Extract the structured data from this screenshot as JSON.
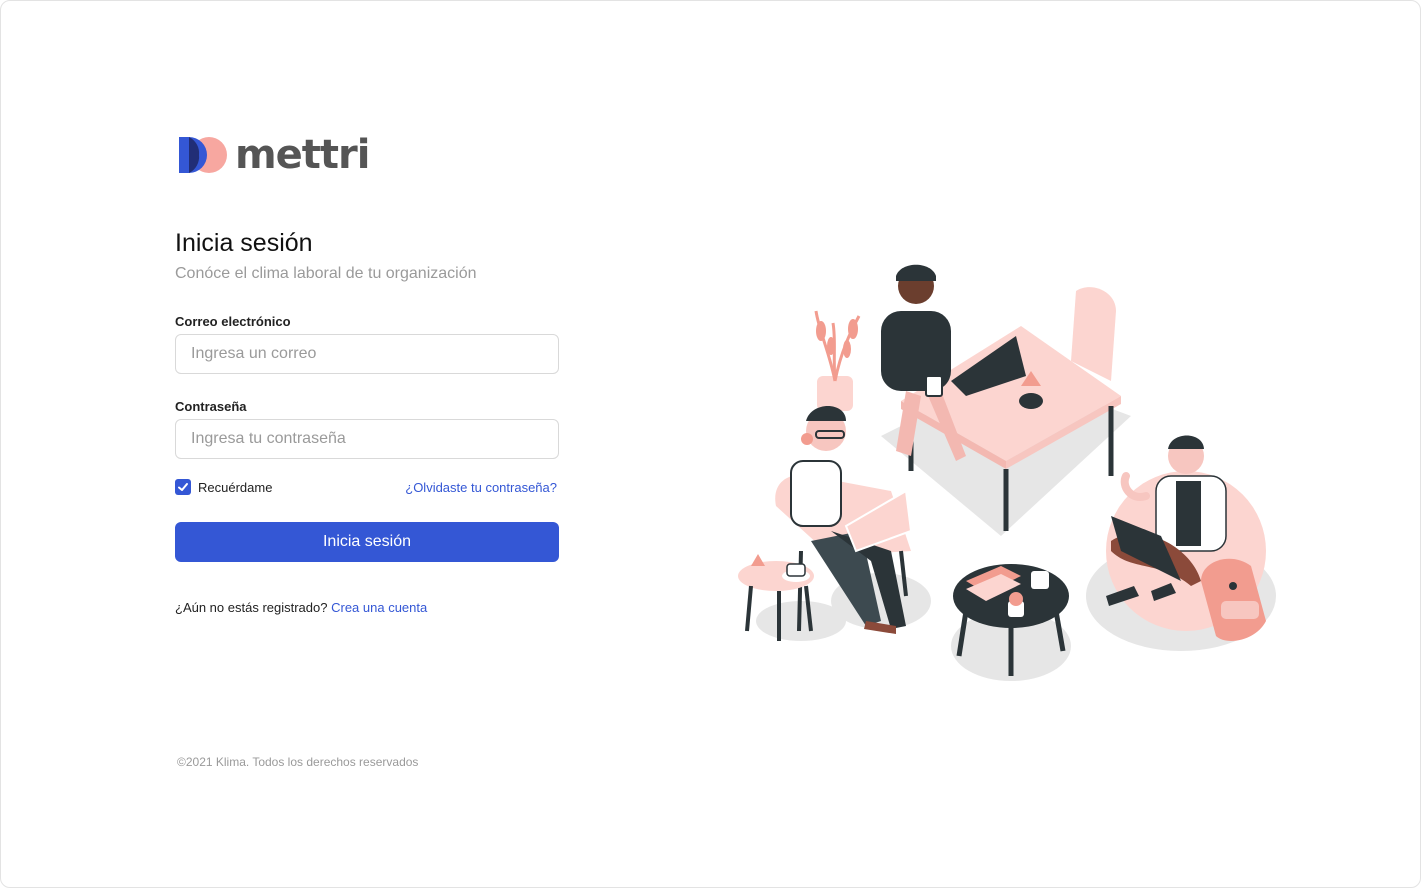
{
  "brand": {
    "name": "mettri",
    "colors": {
      "primary": "#3457d5",
      "accent": "#f7a7a0",
      "dark": "#2b3438"
    }
  },
  "login": {
    "title": "Inicia sesión",
    "subtitle": "Conóce el clima laboral de tu organización",
    "email": {
      "label": "Correo electrónico",
      "placeholder": "Ingresa un correo",
      "value": ""
    },
    "password": {
      "label": "Contraseña",
      "placeholder": "Ingresa tu contraseña",
      "value": ""
    },
    "remember": {
      "label": "Recuérdame",
      "checked": true
    },
    "forgot_link": "¿Olvidaste tu contraseña?",
    "submit_label": "Inicia sesión",
    "register_prompt": "¿Aún no estás registrado?",
    "register_link": "Crea una cuenta"
  },
  "footer": {
    "copyright": "©2021 Klima. Todos los derechos reservados"
  },
  "icons": {
    "logo": "mettri-logo-icon",
    "checkbox": "check-icon",
    "illustration": "coworking-illustration"
  }
}
